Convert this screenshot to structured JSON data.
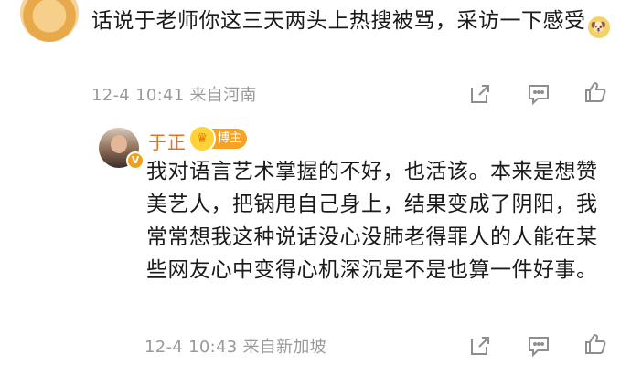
{
  "top_comment": {
    "text": "话说于老师你这三天两头上热搜被骂，采访一下感受",
    "emoji": "doge",
    "time": "12-4 10:41",
    "location": "来自河南"
  },
  "reply": {
    "author": "于正",
    "badge": "博主",
    "text": "我对语言艺术掌握的不好，也活该。本来是想赞美艺人，把锅甩自己身上，结果变成了阴阳，我常常想我这种说话没心没肺老得罪人的人能在某些网友心中变得心机深沉是不是也算一件好事。",
    "time": "12-4 10:43",
    "location": "来自新加坡"
  },
  "icons": {
    "share": "share-icon",
    "comment": "comment-icon",
    "like": "like-icon"
  }
}
